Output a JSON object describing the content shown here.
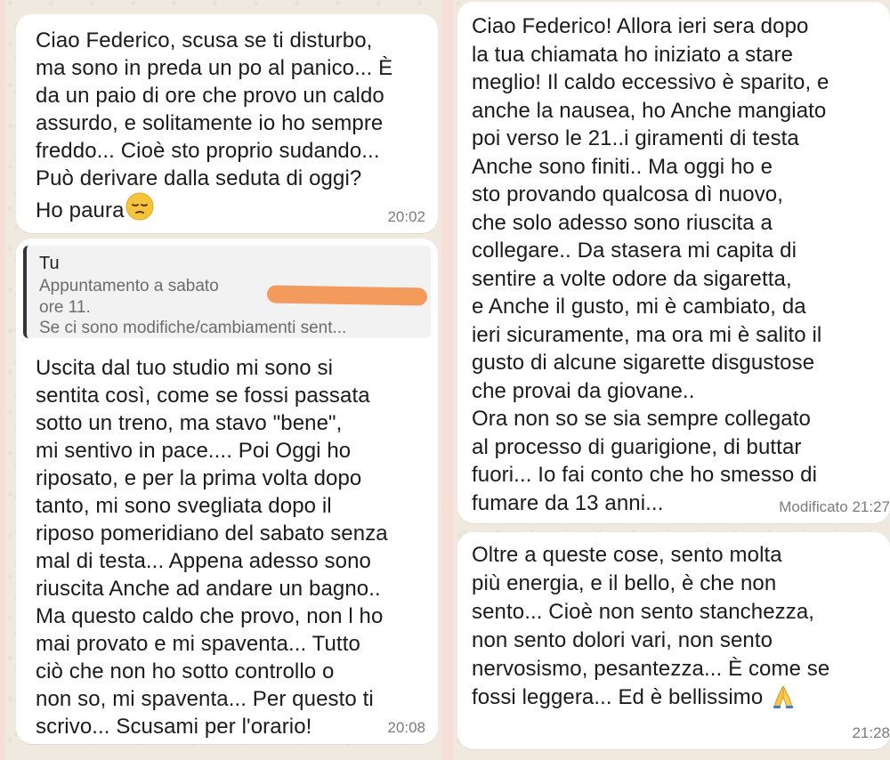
{
  "left_panel": {
    "message1": {
      "text": "Ciao Federico, scusa se ti disturbo,\nma sono in preda un po al panico... È\nda un paio di ore che provo un caldo\nassurdo, e solitamente io ho sempre\nfreddo... Cioè sto proprio sudando...\nPuò derivare dalla seduta di oggi?",
      "last_line": "Ho paura",
      "emoji": "😔",
      "time": "20:02"
    },
    "message2": {
      "quote_author": "Tu",
      "quote_lines": [
        "Appuntamento a sabato",
        "ore 11.",
        "Se ci sono modifiche/cambiamenti sent..."
      ],
      "text": "Uscita dal tuo studio mi sono si\nsentita così, come se fossi passata\nsotto un treno, ma stavo \"bene\",\nmi sentivo in pace.... Poi Oggi ho\nriposato, e per la prima volta dopo\ntanto, mi sono svegliata dopo il\nriposo pomeridiano del sabato senza\nmal di testa... Appena adesso sono\nriuscita Anche ad andare un bagno..\nMa questo caldo che provo, non l ho\nmai provato e mi spaventa... Tutto\nciò che non ho sotto controllo o\nnon so, mi spaventa... Per questo ti\nscrivo... Scusami per l'orario!",
      "time": "20:08"
    }
  },
  "right_panel": {
    "message3": {
      "text": "Ciao Federico! Allora ieri sera dopo\nla tua chiamata ho iniziato a stare\nmeglio! Il caldo eccessivo è sparito, e\nanche la nausea, ho Anche mangiato\npoi verso le 21..i giramenti di testa\nAnche sono finiti.. Ma oggi ho e\nsto provando qualcosa dì nuovo,\nche solo adesso sono riuscita a\ncollegare.. Da stasera mi capita di\nsentire a volte odore da sigaretta,\ne Anche il gusto, mi è cambiato, da\nieri sicuramente, ma ora mi è salito il\ngusto di alcune sigarette disgustose\nche provai da giovane..\nOra non so se sia sempre collegato\nal processo di guarigione, di buttar\nfuori... Io fai conto che ho smesso di\nfumare da 13 anni...",
      "time": "Modificato 21:27"
    },
    "message4": {
      "text": "Oltre a queste cose, sento molta\npiù energia, e il bello, è che non\nsento... Cioè non sento stanchezza,\nnon sento dolori vari, non sento\nnervosismo, pesantezza... È come se",
      "last_line": "fossi leggera... Ed è bellissimo",
      "emoji": "🙏",
      "time": "21:28"
    }
  },
  "colors": {
    "frame": "#f6dfd6",
    "chat_background": "#efe9df",
    "bubble": "#ffffff",
    "quote_bar": "#353535",
    "redaction": "#f39a5d",
    "timestamp": "#7b7b7b"
  }
}
